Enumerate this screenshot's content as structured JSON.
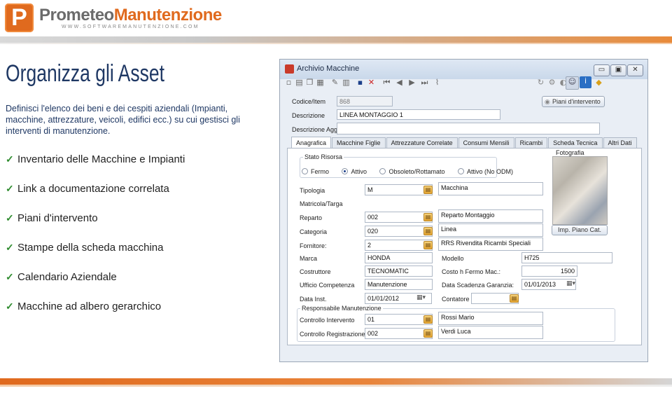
{
  "header": {
    "logo_letter": "P",
    "brand_part1": "Prometeo",
    "brand_part2": "Manutenzione",
    "url": "WWW.SOFTWAREMANUTENZIONE.COM"
  },
  "slide": {
    "title": "Organizza gli Asset",
    "intro": "Definisci l'elenco dei beni e dei cespiti aziendali (Impianti, macchine, attrezzature, veicoli, edifici ecc.) su cui gestisci gli interventi di manutenzione.",
    "bullets": [
      "Inventario delle Macchine e Impianti",
      "Link a documentazione correlata",
      "Piani d'intervento",
      "Stampe della scheda macchina",
      "Calendario Aziendale",
      "Macchine ad albero gerarchico"
    ]
  },
  "window": {
    "title": "Archivio Macchine",
    "buttons": {
      "minimize": "▭",
      "maximize": "▣",
      "close": "✕"
    },
    "codice_label": "Codice/Item",
    "codice_value": "868",
    "descrizione_label": "Descrizione",
    "descrizione_value": "LINEA MONTAGGIO 1",
    "descrizione_agg_label": "Descrizione Agg.",
    "descrizione_agg_value": "",
    "piani_button": "Piani d'intervento",
    "tabs": [
      "Anagrafica",
      "Macchine Figlie",
      "Attrezzature Correlate",
      "Consumi Mensili",
      "Ricambi",
      "Scheda Tecnica",
      "Altri Dati"
    ],
    "stato": {
      "legend": "Stato Risorsa",
      "options": [
        "Fermo",
        "Attivo",
        "Obsoleto/Rottamato",
        "Attivo (No ODM)"
      ],
      "selected": "Attivo"
    },
    "fotografia_label": "Fotografia",
    "fields": {
      "tipologia_label": "Tipologia",
      "tipologia_code": "M",
      "tipologia_desc": "Macchina",
      "matricola_label": "Matricola/Targa",
      "reparto_label": "Reparto",
      "reparto_code": "002",
      "reparto_desc": "Reparto Montaggio",
      "categoria_label": "Categoria",
      "categoria_code": "020",
      "categoria_desc": "Linea",
      "fornitore_label": "Fornitore:",
      "fornitore_code": "2",
      "fornitore_desc": "RRS Rivendita Ricambi Speciali",
      "imp_piano_button": "Imp. Piano Cat.",
      "marca_label": "Marca",
      "marca_value": "HONDA",
      "modello_label": "Modello",
      "modello_value": "H725",
      "costruttore_label": "Costruttore",
      "costruttore_value": "TECNOMATIC",
      "costo_label": "Costo h Fermo Mac.:",
      "costo_value": "1500",
      "ufficio_label": "Ufficio Competenza",
      "ufficio_value": "Manutenzione",
      "scadenza_label": "Data Scadenza Garanzia:",
      "scadenza_value": "01/01/2013",
      "data_inst_label": "Data Inst.",
      "data_inst_value": "01/01/2012",
      "contatore_label": "Contatore",
      "resp_legend": "Responsabile Manutenzione",
      "controllo_int_label": "Controllo Intervento",
      "controllo_int_code": "01",
      "controllo_int_name": "Rossi Mario",
      "controllo_reg_label": "Controllo Registrazione",
      "controllo_reg_code": "002",
      "controllo_reg_name": "Verdi Luca"
    }
  },
  "colors": {
    "accent": "#e06a1e",
    "title": "#1f3864",
    "check": "#2e8b2e"
  }
}
